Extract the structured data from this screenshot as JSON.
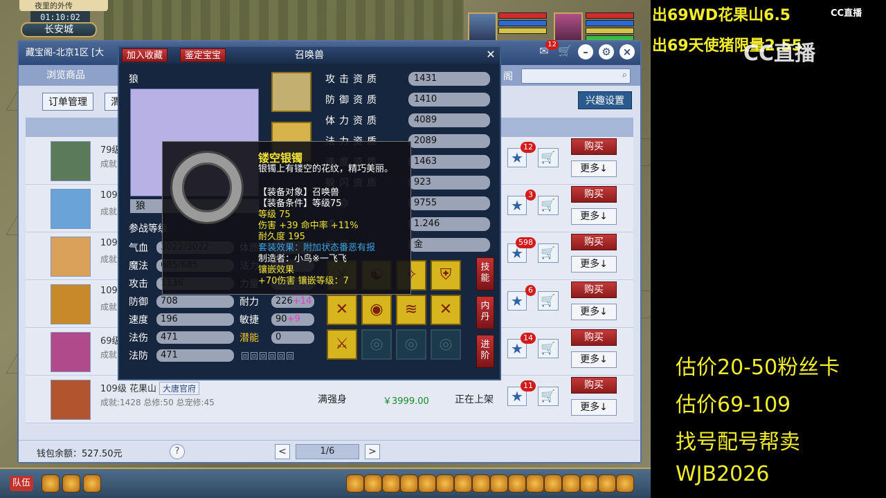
{
  "game": {
    "location_tab": "夜里的外传",
    "clock": "01:10:02",
    "city": "长安城",
    "team_label": "队伍"
  },
  "shop": {
    "title": "藏宝阁-北京1区 [大",
    "nav_browse": "浏览商品",
    "nav_fav": "阁",
    "order_mgmt": "订单管理",
    "order_mgmt2": "渭",
    "interest_settings": "兴趣设置",
    "msg_badge": "12",
    "wallet": "钱包余额：527.50元",
    "help": "?",
    "page": "1/6",
    "prev": "<",
    "next": ">",
    "rows": [
      {
        "line1": "79级",
        "line2": "成就",
        "badge": "12",
        "buy": "购买",
        "more": "更多↓",
        "avatar_color": "#5b7a5a"
      },
      {
        "line1": "109",
        "line2": "成就",
        "badge": "3",
        "buy": "购买",
        "more": "更多↓",
        "avatar_color": "#6aa3d8"
      },
      {
        "line1": "109",
        "line2": "成就",
        "badge": "598",
        "buy": "购买",
        "more": "更多↓",
        "avatar_color": "#d9a15a"
      },
      {
        "line1": "109",
        "line2": "成就",
        "badge": "6",
        "buy": "购买",
        "more": "更多↓",
        "avatar_color": "#c8892a"
      },
      {
        "line1": "69级",
        "line2": "成就",
        "badge": "14",
        "buy": "购买",
        "more": "更多↓",
        "avatar_color": "#b04a8a"
      },
      {
        "line1": "109级  花果山",
        "faction": "大唐官府",
        "line2": "成就:1428 总修:50 总宠修:45",
        "desc": "满强身",
        "price": "￥3999.00",
        "status": "正在上架",
        "badge": "11",
        "buy": "购买",
        "more": "更多↓",
        "avatar_color": "#b2552e"
      }
    ]
  },
  "pet": {
    "title": "召唤兽",
    "btn_fav": "加入收藏",
    "btn_appraise": "鉴定宝宝",
    "close": "✕",
    "name_label": "狼",
    "name_value": "狼",
    "fight_level": "参战等级",
    "stats": [
      {
        "label": "气血",
        "value": "3022/3022"
      },
      {
        "label": "魔法",
        "value": "685/685"
      },
      {
        "label": "攻击",
        "value": "1136"
      },
      {
        "label": "防御",
        "value": "708"
      },
      {
        "label": "速度",
        "value": "196"
      },
      {
        "label": "法伤",
        "value": "471"
      },
      {
        "label": "法防",
        "value": "471"
      }
    ],
    "stats_right": [
      {
        "label": "体质",
        "value": ""
      },
      {
        "label": "法力",
        "value": ""
      },
      {
        "label": "力量",
        "value": ""
      },
      {
        "label": "耐力",
        "value": "226",
        "plus": "+14"
      },
      {
        "label": "敏捷",
        "value": "90",
        "plus": "+9"
      },
      {
        "label": "潜能",
        "value": "0"
      }
    ],
    "aptitudes": [
      {
        "label": "攻击资质",
        "value": "1431"
      },
      {
        "label": "防御资质",
        "value": "1410"
      },
      {
        "label": "体力资质",
        "value": "4089"
      },
      {
        "label": "法力资质",
        "value": "2089"
      },
      {
        "label": "速度资质",
        "value": "1463"
      },
      {
        "label": "躲闪资质",
        "value": "923"
      },
      {
        "label": "寿命",
        "value": "9755"
      },
      {
        "label": "成长",
        "value": "1.246"
      },
      {
        "label": "五行",
        "value": "金"
      }
    ],
    "tabs": [
      "技能",
      "内丹",
      "进阶"
    ],
    "pattern": "回回回回回回"
  },
  "tooltip": {
    "name": "镂空银镯",
    "desc": "银镯上有镂空的花纹，精巧美丽。",
    "target": "【装备对象】召唤兽",
    "condition": "【装备条件】等级75",
    "level": "等级 75",
    "damage": "伤害 +39 命中率 +11%",
    "durability": "耐久度 195",
    "set_effect": "套装效果：附加状态番恶有报",
    "maker": "制造者：小鸟※一飞飞",
    "inlay_effect": "镶嵌效果",
    "inlay": "+70伤害 镶嵌等级：7"
  },
  "overlay": {
    "top1": "出69WD花果山6.5",
    "top2": "出69天使猪限量2.55",
    "cc_small": "CC直播",
    "cc_big": "CC直播",
    "lines": [
      "估价20-50粉丝卡",
      "估价69-109",
      "找号配号帮卖",
      " WJB2026"
    ]
  },
  "colors": {
    "overlay_text": "#f2ec2b",
    "buy_red": "#c23a3a",
    "pet_bg": "#17263f"
  }
}
